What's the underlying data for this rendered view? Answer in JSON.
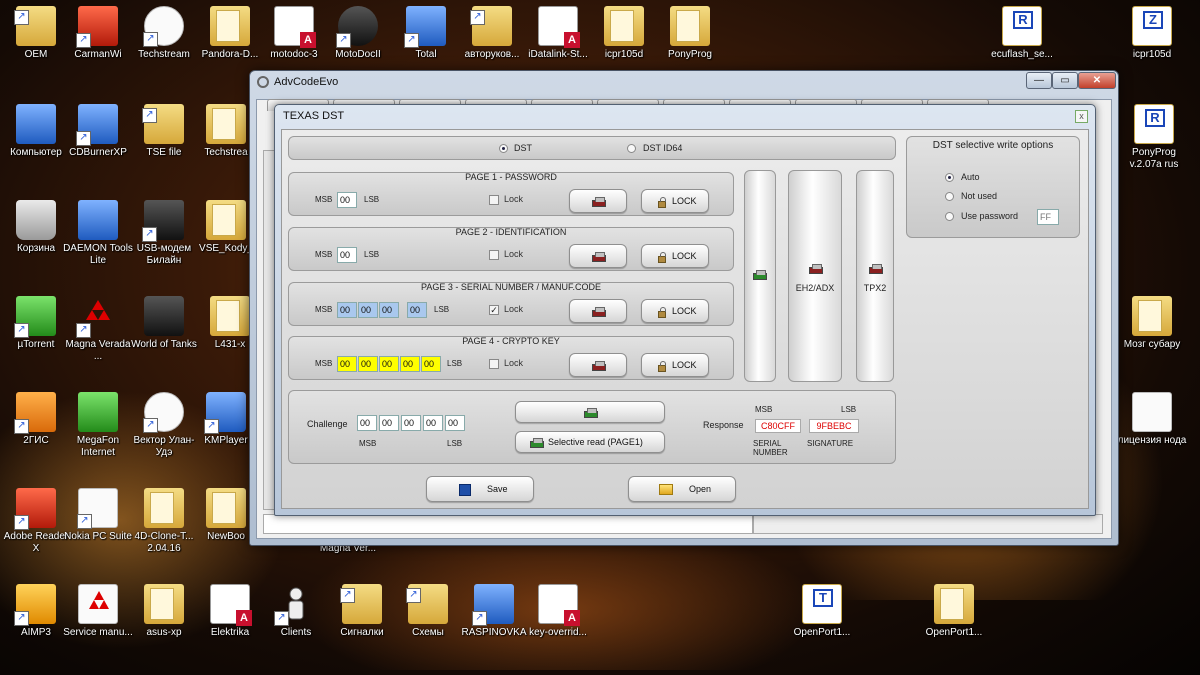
{
  "desktop": {
    "icons": [
      {
        "id": "oem",
        "label": "OEM"
      },
      {
        "id": "carmanwi",
        "label": "CarmanWi"
      },
      {
        "id": "techstream1",
        "label": "Techstream"
      },
      {
        "id": "pandora",
        "label": "Pandora-D..."
      },
      {
        "id": "motodoc3",
        "label": "motodoc-3"
      },
      {
        "id": "motodocii",
        "label": "MotoDocII"
      },
      {
        "id": "total",
        "label": "Total"
      },
      {
        "id": "avtorukov",
        "label": "авторуков..."
      },
      {
        "id": "idatalink",
        "label": "iDatalink-St..."
      },
      {
        "id": "icpr105d_1",
        "label": "icpr105d"
      },
      {
        "id": "ponyprog_1",
        "label": "PonyProg"
      },
      {
        "id": "ecuflash",
        "label": "ecuflash_se..."
      },
      {
        "id": "icpr105d_2",
        "label": "icpr105d"
      },
      {
        "id": "computer",
        "label": "Компьютер"
      },
      {
        "id": "cdburner",
        "label": "CDBurnerXP"
      },
      {
        "id": "tsefile",
        "label": "TSE file"
      },
      {
        "id": "techstream2",
        "label": "Techstrea"
      },
      {
        "id": "ponyprog_2",
        "label": "PonyProg v.2.07a rus"
      },
      {
        "id": "recycle",
        "label": "Корзина"
      },
      {
        "id": "daemon",
        "label": "DAEMON Tools Lite"
      },
      {
        "id": "usbmodem",
        "label": "USB-модем Билайн"
      },
      {
        "id": "vsekody",
        "label": "VSE_Kody_"
      },
      {
        "id": "utorrent",
        "label": "µTorrent"
      },
      {
        "id": "magna",
        "label": "Magna Verada ..."
      },
      {
        "id": "wot",
        "label": "World of Tanks"
      },
      {
        "id": "l431",
        "label": "L431-x"
      },
      {
        "id": "mozg",
        "label": "Мозг субару"
      },
      {
        "id": "2gis",
        "label": "2ГИС"
      },
      {
        "id": "megafon",
        "label": "MegaFon Internet"
      },
      {
        "id": "vektor",
        "label": "Вектор Улан-Удэ"
      },
      {
        "id": "kmplayer",
        "label": "KMPlayer"
      },
      {
        "id": "license",
        "label": "лицензия нода"
      },
      {
        "id": "adobe",
        "label": "Adobe Reader X"
      },
      {
        "id": "nokia",
        "label": "Nokia PC Suite"
      },
      {
        "id": "4dclone",
        "label": "4D-Clone-T... 2.04.16"
      },
      {
        "id": "newbook",
        "label": "NewBoo"
      },
      {
        "id": "aimp",
        "label": "AIMP3"
      },
      {
        "id": "servicemanu",
        "label": "Service manu..."
      },
      {
        "id": "asusxp",
        "label": "asus-xp"
      },
      {
        "id": "elektrika",
        "label": "Elektrika"
      },
      {
        "id": "clients",
        "label": "Clients"
      },
      {
        "id": "signalki",
        "label": "Сигналки"
      },
      {
        "id": "shemy",
        "label": "Схемы"
      },
      {
        "id": "raspinovka",
        "label": "RASPINOVKA"
      },
      {
        "id": "keyoverride",
        "label": "key-overrid..."
      },
      {
        "id": "openport1",
        "label": "OpenPort1..."
      },
      {
        "id": "openport2",
        "label": "OpenPort1..."
      }
    ],
    "partial_label": "Magna Ver..."
  },
  "outer_window": {
    "title": "AdvCodeEvo",
    "min": "—",
    "max": "▭",
    "close": "✕"
  },
  "dialog": {
    "title": "TEXAS DST",
    "close": "x",
    "mode": {
      "options": [
        "DST",
        "DST ID64"
      ],
      "selected": "DST"
    },
    "pages": [
      {
        "title": "PAGE 1 - PASSWORD",
        "msb": "MSB",
        "lsb": "LSB",
        "fields": [
          "00"
        ],
        "lock_checked": false,
        "lock_label": "Lock",
        "lock_button": "LOCK"
      },
      {
        "title": "PAGE 2 - IDENTIFICATION",
        "msb": "MSB",
        "lsb": "LSB",
        "fields": [
          "00"
        ],
        "lock_checked": false,
        "lock_label": "Lock",
        "lock_button": "LOCK"
      },
      {
        "title": "PAGE 3 - SERIAL NUMBER / MANUF.CODE",
        "msb": "MSB",
        "lsb": "LSB",
        "fields": [
          "00",
          "00",
          "00",
          "00"
        ],
        "lock_checked": true,
        "lock_label": "Lock",
        "lock_button": "LOCK"
      },
      {
        "title": "PAGE 4 - CRYPTO KEY",
        "msb": "MSB",
        "lsb": "LSB",
        "fields": [
          "00",
          "00",
          "00",
          "00",
          "00"
        ],
        "lock_checked": false,
        "lock_label": "Lock",
        "lock_button": "LOCK"
      }
    ],
    "side_buttons": [
      "",
      "EH2/ADX",
      "TPX2"
    ],
    "write_options": {
      "title": "DST selective write options",
      "options": [
        "Auto",
        "Not used",
        "Use password"
      ],
      "selected": "Auto",
      "password_value": "FF"
    },
    "challenge": {
      "label": "Challenge",
      "fields": [
        "00",
        "00",
        "00",
        "00",
        "00"
      ],
      "msb": "MSB",
      "lsb": "LSB"
    },
    "selective_read_label": "Selective read (PAGE1)",
    "response": {
      "label": "Response",
      "msb": "MSB",
      "lsb": "LSB",
      "serial_value": "C80CFF",
      "signature_value": "9FBEBC",
      "serial_label_1": "SERIAL",
      "serial_label_2": "NUMBER",
      "signature_label": "SIGNATURE"
    },
    "save_label": "Save",
    "open_label": "Open"
  }
}
